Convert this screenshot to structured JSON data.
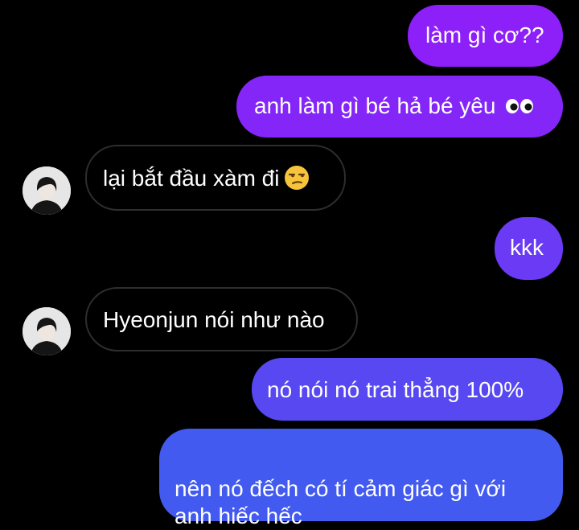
{
  "colors": {
    "background": "#000000",
    "incoming_border": "#2e2e2e",
    "gradient_top": "#8c20f8",
    "gradient_bottom": "#3f66f0"
  },
  "messages": [
    {
      "side": "outgoing",
      "text": "làm gì cơ??",
      "color": "#8d1ff9"
    },
    {
      "side": "outgoing",
      "text": "anh làm gì bé hả bé yêu",
      "emoji": "eyes-emoji",
      "color": "#8526f8"
    },
    {
      "side": "incoming",
      "text": "lại bắt đầu xàm đi",
      "emoji": "unamused-face-emoji"
    },
    {
      "side": "outgoing",
      "text": "kkk",
      "color": "#6a3af4"
    },
    {
      "side": "incoming",
      "text": "Hyeonjun nói như nào"
    },
    {
      "side": "outgoing",
      "text": "nó nói nó trai thẳng 100%",
      "color": "#5748f2"
    },
    {
      "side": "outgoing",
      "text": "nên nó đếch có tí cảm giác gì với\nanh hiếc hếc",
      "color": "#425aef"
    }
  ]
}
